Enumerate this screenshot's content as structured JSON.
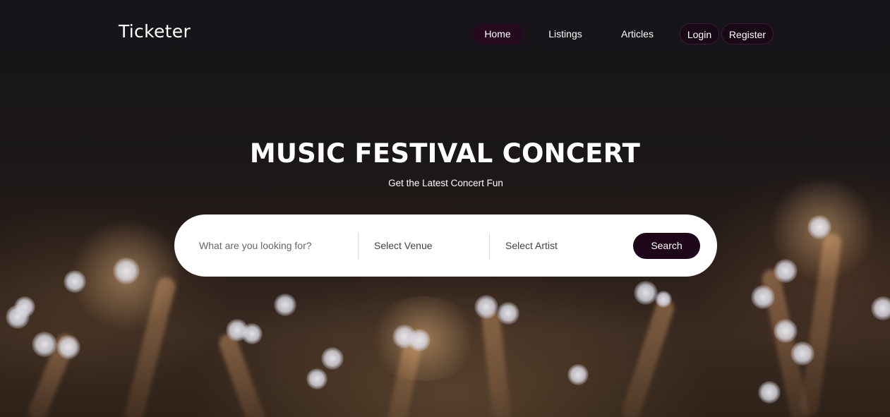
{
  "brand": {
    "logo": "Ticketer"
  },
  "nav": {
    "items": [
      {
        "label": "Home",
        "active": true
      },
      {
        "label": "Listings",
        "active": false
      },
      {
        "label": "Articles",
        "active": false
      }
    ],
    "login_label": "Login",
    "register_label": "Register"
  },
  "hero": {
    "title": "MUSIC FESTIVAL CONCERT",
    "subtitle": "Get the Latest Concert Fun"
  },
  "search": {
    "query_placeholder": "What are you looking for?",
    "venue_label": "Select Venue",
    "artist_label": "Select Artist",
    "button_label": "Search"
  },
  "colors": {
    "accent": "#1d0718",
    "nav_active_bg": "#25091f",
    "text_on_dark": "#ffffff",
    "search_bg": "#ffffff"
  }
}
